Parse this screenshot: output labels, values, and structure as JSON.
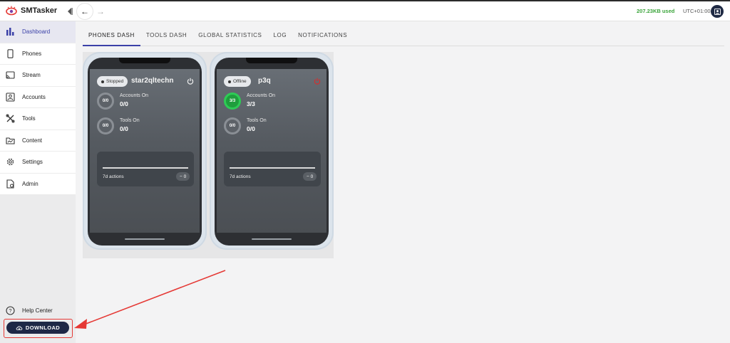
{
  "app": {
    "title": "SMTasker",
    "storage_used": "207.23KB used",
    "timezone": "UTC+01:00"
  },
  "sidebar": {
    "items": [
      {
        "label": "Dashboard",
        "icon": "bar-chart-icon",
        "active": true
      },
      {
        "label": "Phones",
        "icon": "phone-icon"
      },
      {
        "label": "Stream",
        "icon": "cast-icon"
      },
      {
        "label": "Accounts",
        "icon": "account-box-icon"
      },
      {
        "label": "Tools",
        "icon": "tools-icon"
      },
      {
        "label": "Content",
        "icon": "folder-icon"
      },
      {
        "label": "Settings",
        "icon": "gear-icon"
      },
      {
        "label": "Admin",
        "icon": "admin-icon"
      }
    ],
    "help_label": "Help Center",
    "download_label": "DOWNLOAD"
  },
  "tabs": [
    {
      "label": "PHONES DASH",
      "active": true
    },
    {
      "label": "TOOLS DASH"
    },
    {
      "label": "GLOBAL STATISTICS"
    },
    {
      "label": "LOG"
    },
    {
      "label": "NOTIFICATIONS"
    }
  ],
  "phones": [
    {
      "status": "Stopped",
      "name": "star2qltechn",
      "action_icon": "power-icon",
      "accounts_label": "Accounts On",
      "accounts_ring": "0/0",
      "accounts_value": "0/0",
      "tools_label": "Tools On",
      "tools_ring": "0/0",
      "tools_value": "0/0",
      "actions_label": "7d actions",
      "actions_count": "− 0"
    },
    {
      "status": "Offline",
      "name": "p3q",
      "action_icon": "power-off-red-icon",
      "accounts_label": "Accounts On",
      "accounts_ring": "3/3",
      "accounts_value": "3/3",
      "tools_label": "Tools On",
      "tools_ring": "0/0",
      "tools_value": "0/0",
      "actions_label": "7d actions",
      "actions_count": "− 0"
    }
  ],
  "colors": {
    "accent": "#3b41a8",
    "download_bg": "#1e2846",
    "storage_text": "#3aa43a",
    "annotation": "#e53935",
    "ring_active": "#2ecc55"
  }
}
